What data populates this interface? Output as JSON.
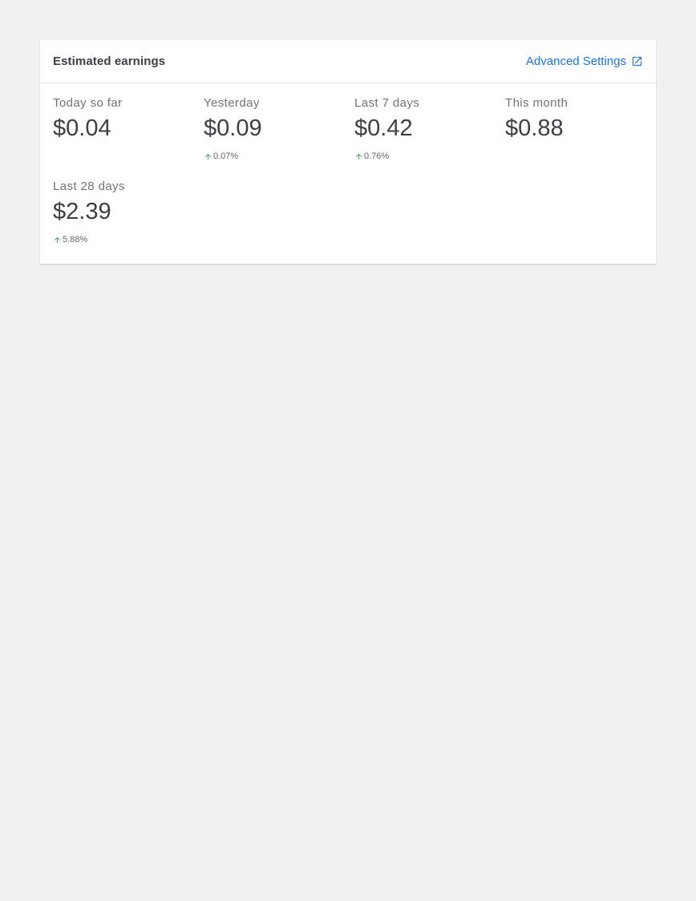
{
  "card": {
    "title": "Estimated earnings",
    "advanced_settings_label": "Advanced Settings",
    "advanced_settings_icon": "external-link-icon",
    "accent_color": "#1a73e8",
    "positive_color": "#34a853"
  },
  "stats": [
    {
      "label": "Today so far",
      "value": "$0.04",
      "change": null
    },
    {
      "label": "Yesterday",
      "value": "$0.09",
      "change": "0.07%",
      "change_direction": "up"
    },
    {
      "label": "Last 7 days",
      "value": "$0.42",
      "change": "0.76%",
      "change_direction": "up"
    },
    {
      "label": "This month",
      "value": "$0.88",
      "change": null
    },
    {
      "label": "Last 28 days",
      "value": "$2.39",
      "change": "5.88%",
      "change_direction": "up"
    }
  ]
}
